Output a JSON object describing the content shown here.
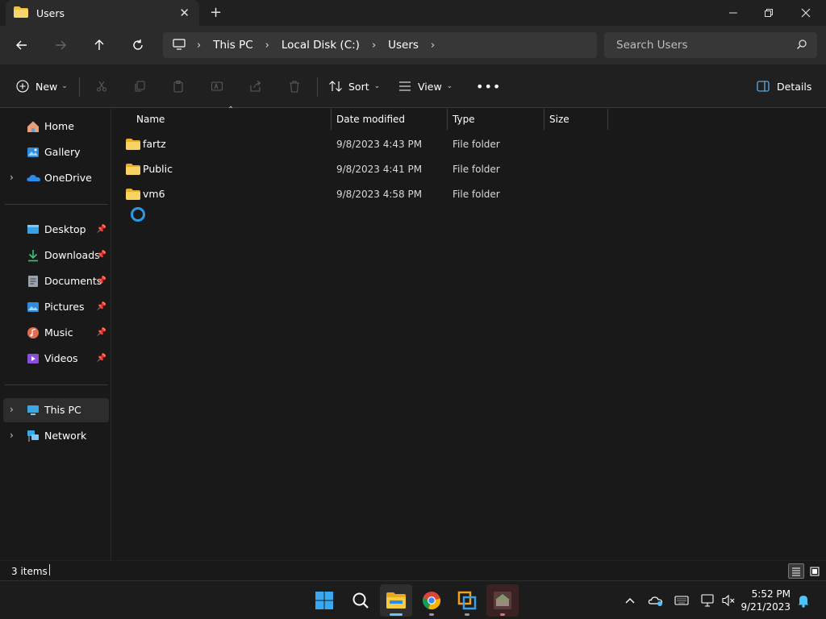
{
  "window": {
    "tab_title": "Users"
  },
  "address": {
    "crumbs": [
      "This PC",
      "Local Disk (C:)",
      "Users"
    ]
  },
  "search": {
    "placeholder": "Search Users"
  },
  "toolbar": {
    "new_label": "New",
    "sort_label": "Sort",
    "view_label": "View",
    "details_label": "Details"
  },
  "sidebar": {
    "items": [
      {
        "label": "Home",
        "icon": "home-icon"
      },
      {
        "label": "Gallery",
        "icon": "gallery-icon"
      },
      {
        "label": "OneDrive",
        "icon": "onedrive-icon"
      },
      {
        "label": "Desktop",
        "icon": "desktop-icon",
        "pinned": true
      },
      {
        "label": "Downloads",
        "icon": "downloads-icon",
        "pinned": true
      },
      {
        "label": "Documents",
        "icon": "documents-icon",
        "pinned": true
      },
      {
        "label": "Pictures",
        "icon": "pictures-icon",
        "pinned": true
      },
      {
        "label": "Music",
        "icon": "music-icon",
        "pinned": true
      },
      {
        "label": "Videos",
        "icon": "videos-icon",
        "pinned": true
      },
      {
        "label": "This PC",
        "icon": "this-pc-icon",
        "selected": true
      },
      {
        "label": "Network",
        "icon": "network-icon"
      }
    ]
  },
  "columns": {
    "name": "Name",
    "date": "Date modified",
    "type": "Type",
    "size": "Size"
  },
  "files": [
    {
      "name": "fartz",
      "date": "9/8/2023 4:43 PM",
      "type": "File folder",
      "size": ""
    },
    {
      "name": "Public",
      "date": "9/8/2023 4:41 PM",
      "type": "File folder",
      "size": ""
    },
    {
      "name": "vm6",
      "date": "9/8/2023 4:58 PM",
      "type": "File folder",
      "size": ""
    }
  ],
  "status": {
    "item_count": "3 items"
  },
  "taskbar": {
    "time": "5:52 PM",
    "date": "9/21/2023"
  },
  "colors": {
    "folder": "#f3c23b",
    "accent": "#4cc2ff",
    "background": "#191919"
  }
}
